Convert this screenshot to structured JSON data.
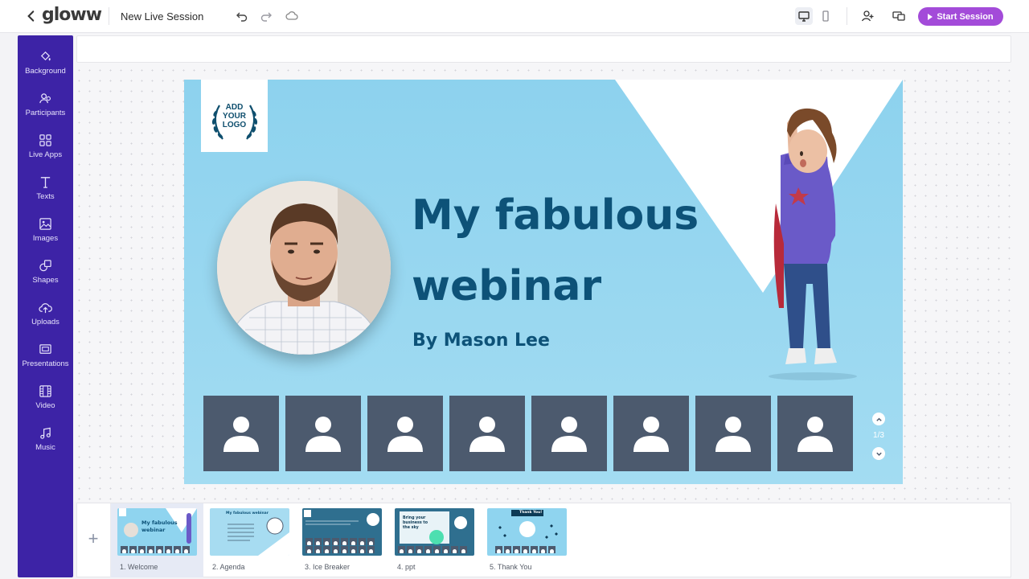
{
  "header": {
    "logo": "gloww",
    "session_name": "New Live Session",
    "start_label": "Start Session"
  },
  "sidebar": {
    "items": [
      {
        "label": "Background",
        "icon": "paint-bucket-icon"
      },
      {
        "label": "Participants",
        "icon": "participants-icon"
      },
      {
        "label": "Live Apps",
        "icon": "grid-icon"
      },
      {
        "label": "Texts",
        "icon": "text-icon"
      },
      {
        "label": "Images",
        "icon": "image-icon"
      },
      {
        "label": "Shapes",
        "icon": "shapes-icon"
      },
      {
        "label": "Uploads",
        "icon": "upload-icon"
      },
      {
        "label": "Presentations",
        "icon": "presentation-icon"
      },
      {
        "label": "Video",
        "icon": "video-icon"
      },
      {
        "label": "Music",
        "icon": "music-icon"
      }
    ]
  },
  "slide": {
    "logo_text": [
      "ADD",
      "YOUR",
      "LOGO"
    ],
    "title_line1": "My fabulous",
    "title_line2": "webinar",
    "byline": "By Mason Lee",
    "participant_tiles": 8,
    "pager": "1/3"
  },
  "thumbnails": [
    {
      "label": "1. Welcome",
      "title": "My fabulous webinar"
    },
    {
      "label": "2. Agenda",
      "title": "My fabulous webinar"
    },
    {
      "label": "3. Ice Breaker"
    },
    {
      "label": "4. ppt",
      "title": "Bring your business to the sky"
    },
    {
      "label": "5. Thank You",
      "title": "Thank You!"
    }
  ],
  "colors": {
    "sidebar": "#3d23a6",
    "accent": "#a34bd9",
    "slide_bg": "#8fd4ef",
    "title": "#0d5278",
    "tile": "#4c5a6e"
  }
}
